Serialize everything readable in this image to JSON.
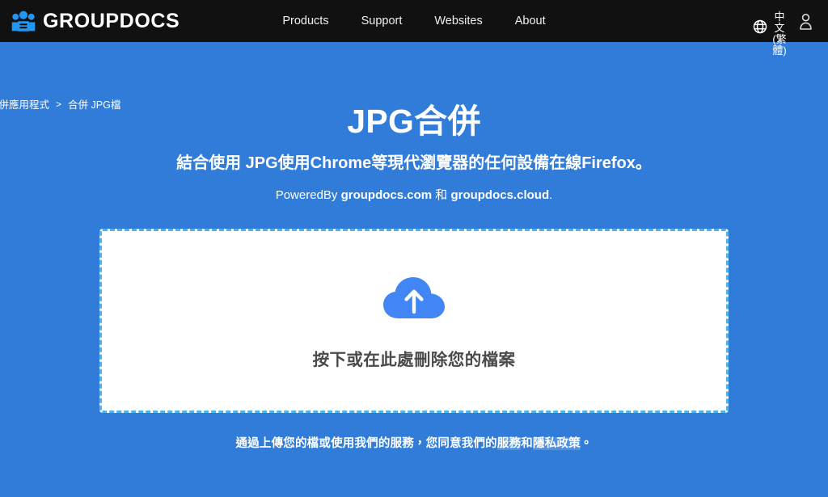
{
  "header": {
    "brand": {
      "name": "GROUPDOCS",
      "icon": "group-people-icon"
    },
    "nav": [
      {
        "label": "Products"
      },
      {
        "label": "Support"
      },
      {
        "label": "Websites"
      },
      {
        "label": "About"
      }
    ],
    "language": {
      "icon": "globe-icon",
      "label": "中文(繁體)"
    },
    "account": {
      "icon": "user-icon"
    }
  },
  "breadcrumb": {
    "items": [
      {
        "label": "合併應用程式"
      },
      {
        "label": "合併 JPG檔"
      }
    ],
    "separator": ">"
  },
  "hero": {
    "title": "JPG合併",
    "subtitle": "結合使用 JPG使用Chrome等現代瀏覽器的任何設備在線Firefox。",
    "powered_prefix": "PoweredBy ",
    "powered_site1": "groupdocs.com",
    "powered_conjunction": " 和 ",
    "powered_site2": "groupdocs.cloud",
    "powered_suffix": "."
  },
  "dropzone": {
    "icon": "cloud-upload-icon",
    "label": "按下或在此處刪除您的檔案"
  },
  "terms": {
    "text_before": "通過上傳您的檔或使用我們的服務，您同意我們的",
    "link_terms": "服務",
    "text_between": "和",
    "link_privacy": "隱私政策",
    "text_after": "。"
  },
  "colors": {
    "page_background": "#317cd8",
    "header_background": "#111111",
    "accent_blue": "#4285f4",
    "dash_border": "#4bb3f0",
    "dropzone_background": "#ffffff",
    "dropzone_text": "#4a4a4a"
  }
}
